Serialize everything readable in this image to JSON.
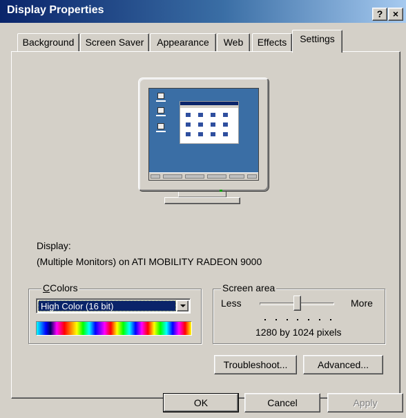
{
  "window": {
    "title": "Display Properties",
    "help_button": "?",
    "close_button": "×"
  },
  "tabs": [
    {
      "label": "Background",
      "active": false
    },
    {
      "label": "Screen Saver",
      "active": false
    },
    {
      "label": "Appearance",
      "active": false
    },
    {
      "label": "Web",
      "active": false
    },
    {
      "label": "Effects",
      "active": false
    },
    {
      "label": "Settings",
      "active": true
    }
  ],
  "display": {
    "label": "Display:",
    "value": "(Multiple Monitors) on ATI MOBILITY RADEON 9000"
  },
  "colors": {
    "legend": "Colors",
    "selected": "High Color (16 bit)"
  },
  "screen_area": {
    "legend": "Screen area",
    "less_label": "Less",
    "more_label": "More",
    "resolution_text": "1280 by 1024 pixels",
    "slider_position": 0.5
  },
  "buttons": {
    "troubleshoot": "Troubleshoot...",
    "advanced": "Advanced...",
    "ok": "OK",
    "cancel": "Cancel",
    "apply": "Apply"
  },
  "colors_theme": {
    "titlebar_start": "#0a246a",
    "titlebar_end": "#a6caf0",
    "face": "#d4d0c8",
    "desktop": "#3a6ea5",
    "selection": "#0a246a"
  }
}
